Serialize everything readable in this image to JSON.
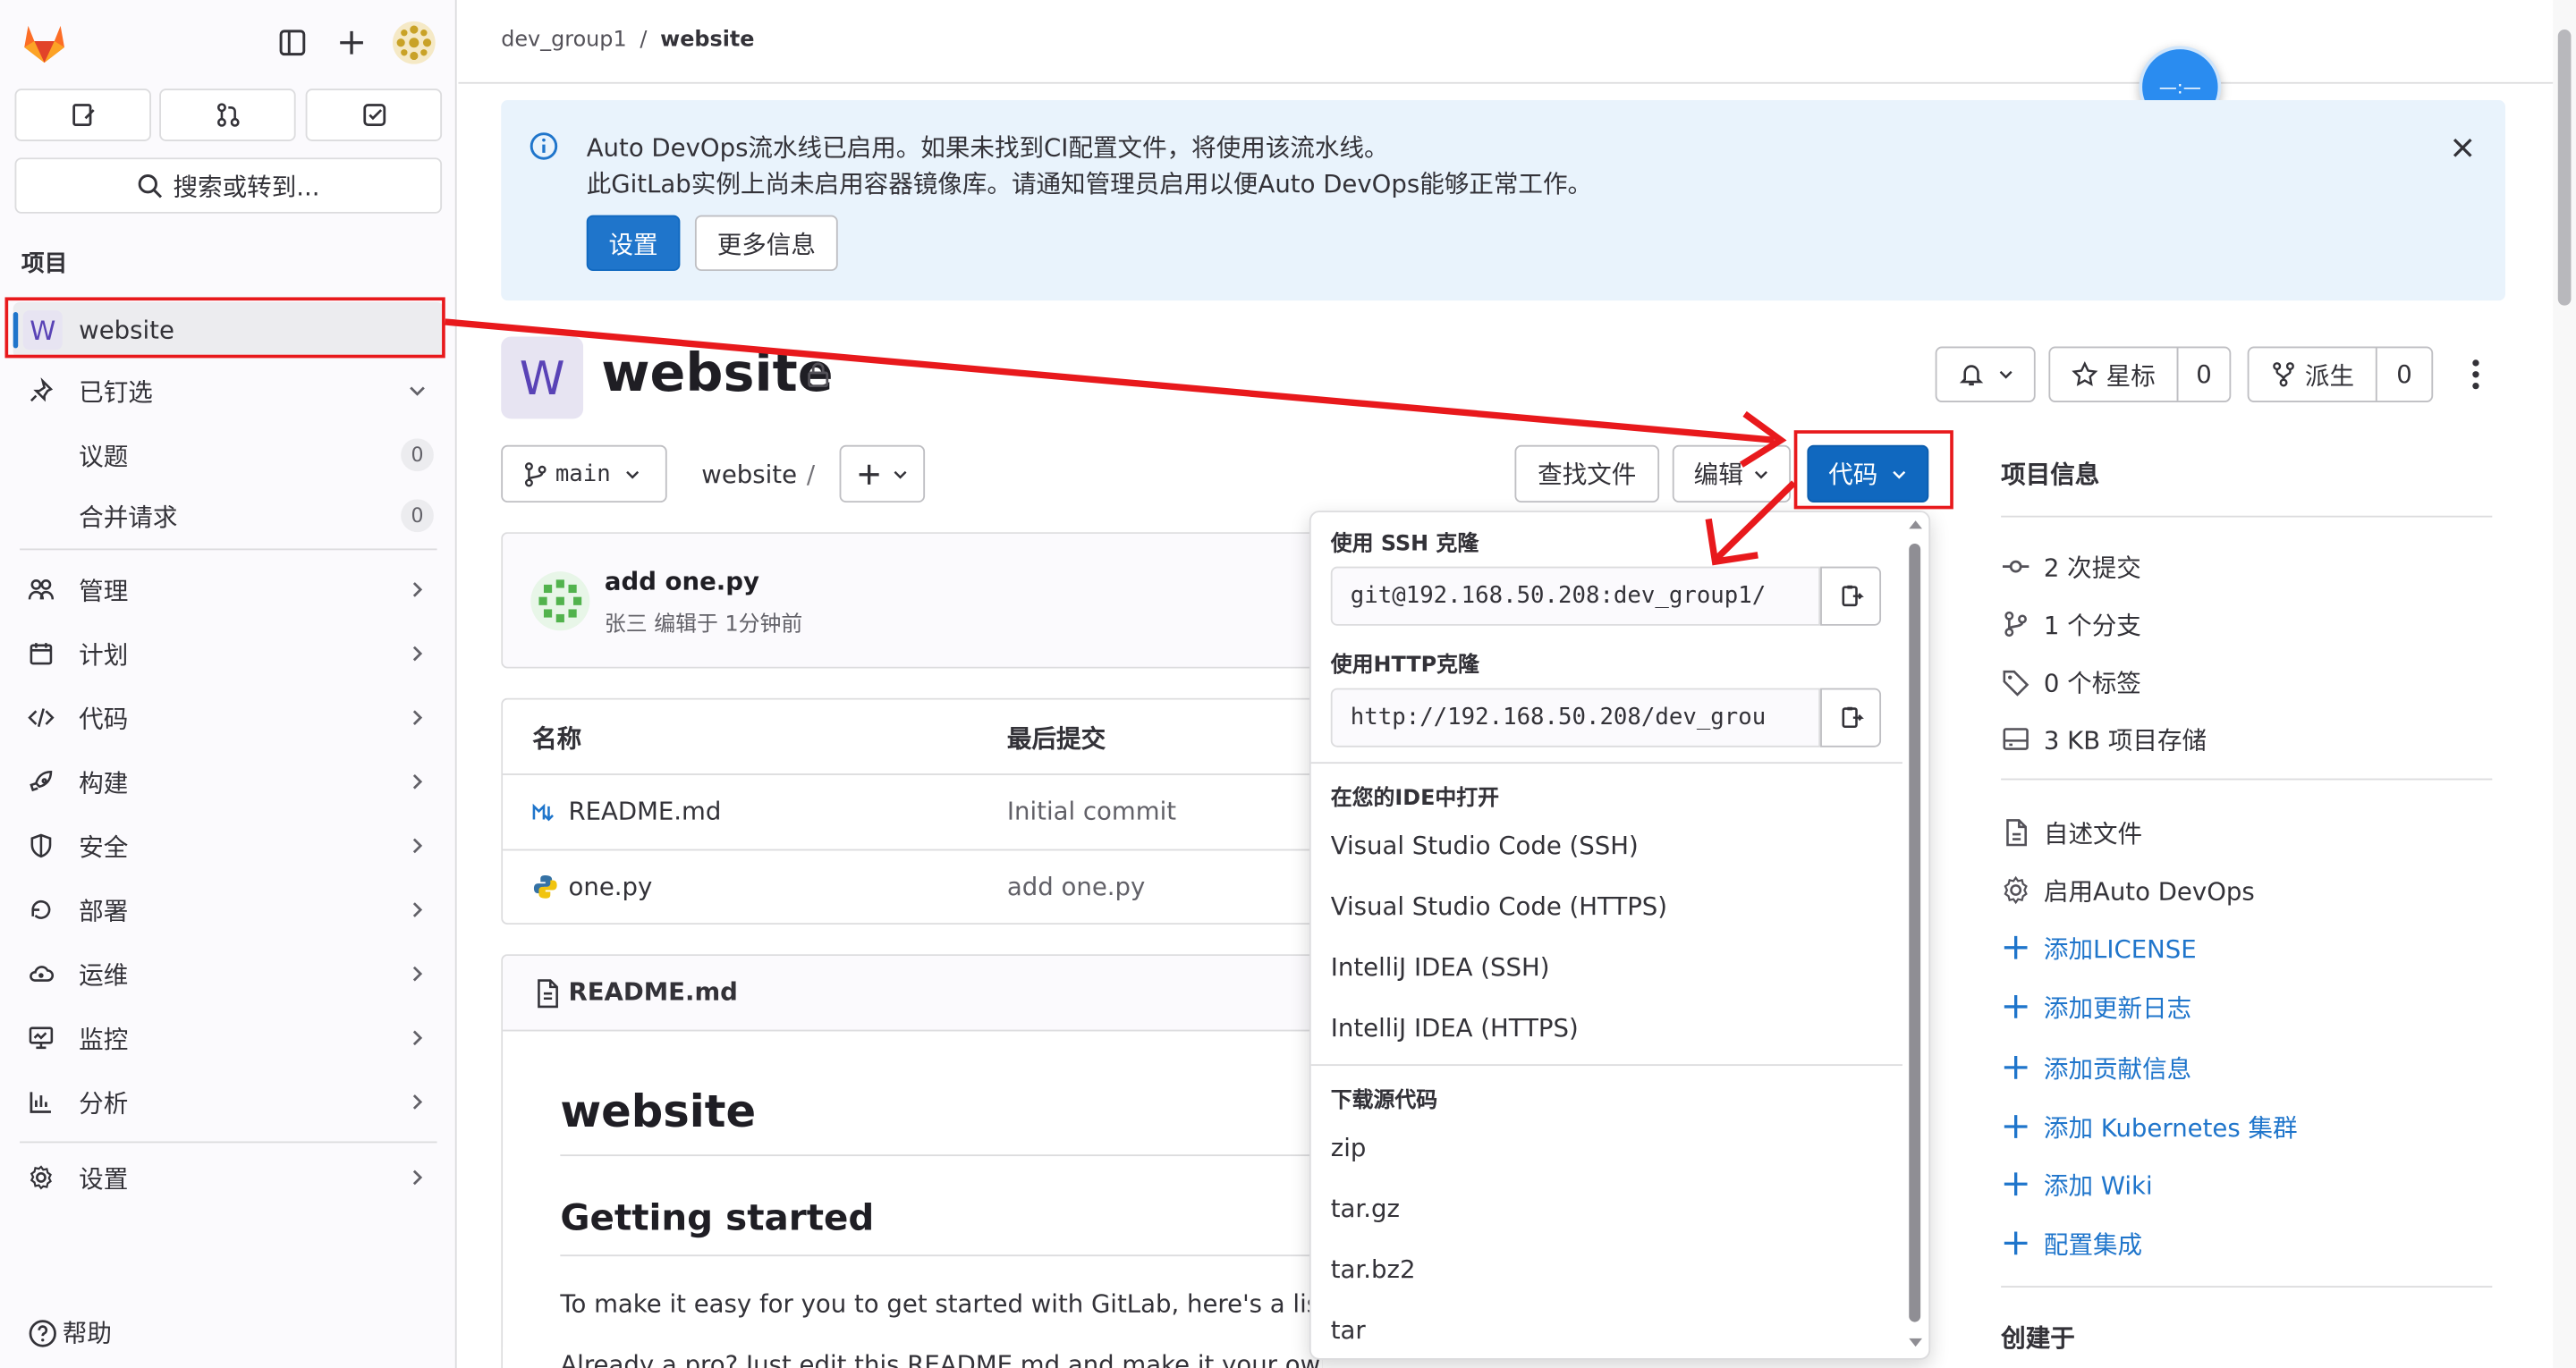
{
  "sidebar": {
    "project_heading": "项目",
    "project_avatar_letter": "W",
    "project_name": "website",
    "pinned_label": "已钉选",
    "pinned_items": [
      {
        "label": "议题",
        "count": "0"
      },
      {
        "label": "合并请求",
        "count": "0"
      }
    ],
    "nav_items": [
      "管理",
      "计划",
      "代码",
      "构建",
      "安全",
      "部署",
      "运维",
      "监控",
      "分析"
    ],
    "settings_label": "设置",
    "search_label": "搜索或转到...",
    "help_label": "帮助"
  },
  "breadcrumb": {
    "group": "dev_group1",
    "separator": "/",
    "project": "website"
  },
  "alert": {
    "line1": "Auto DevOps流水线已启用。如果未找到CI配置文件，将使用该流水线。",
    "line2": "此GitLab实例上尚未启用容器镜像库。请通知管理员启用以便Auto DevOps能够正常工作。",
    "settings_button": "设置",
    "more_info_button": "更多信息"
  },
  "project": {
    "avatar_letter": "W",
    "title": "website",
    "star_label": "星标",
    "star_count": "0",
    "fork_label": "派生",
    "fork_count": "0"
  },
  "repo_toolbar": {
    "branch": "main",
    "path": "website",
    "path_sep": "/",
    "find_file": "查找文件",
    "edit": "编辑",
    "code": "代码"
  },
  "last_commit": {
    "message": "add one.py",
    "author_meta": "张三 编辑于 1分钟前"
  },
  "file_table": {
    "headers": [
      "名称",
      "最后提交"
    ],
    "rows": [
      {
        "name": "README.md",
        "commit": "Initial commit"
      },
      {
        "name": "one.py",
        "commit": "add one.py"
      }
    ]
  },
  "readme": {
    "header": "README.md",
    "h1": "website",
    "h2": "Getting started",
    "p1": "To make it easy for you to get started with GitLab, here's a list o",
    "p2": "Already a pro? Just edit this README.md and make it your own. Want to make it easy? Use the template at the"
  },
  "code_dropdown": {
    "ssh_heading": "使用 SSH 克隆",
    "ssh_url": "git@192.168.50.208:dev_group1/",
    "http_heading": "使用HTTP克隆",
    "http_url": "http://192.168.50.208/dev_grou",
    "ide_heading": "在您的IDE中打开",
    "ide_items": [
      "Visual Studio Code (SSH)",
      "Visual Studio Code (HTTPS)",
      "IntelliJ IDEA (SSH)",
      "IntelliJ IDEA (HTTPS)"
    ],
    "download_heading": "下载源代码",
    "download_items": [
      "zip",
      "tar.gz",
      "tar.bz2",
      "tar"
    ]
  },
  "project_info": {
    "heading": "项目信息",
    "stats": [
      "2 次提交",
      "1 个分支",
      "0 个标签",
      "3 KB 项目存储"
    ],
    "readme_link": "自述文件",
    "devops_link": "启用Auto DevOps",
    "add_links": [
      "添加LICENSE",
      "添加更新日志",
      "添加贡献信息",
      "添加 Kubernetes 集群",
      "添加 Wiki",
      "配置集成"
    ],
    "created_heading": "创建于"
  },
  "float_widget_text": "—:—",
  "colors": {
    "accent": "#1f75cb",
    "annotation": "#e8191c",
    "alert_bg": "#e9f3fc",
    "project_avatar": "#6e49cb"
  }
}
